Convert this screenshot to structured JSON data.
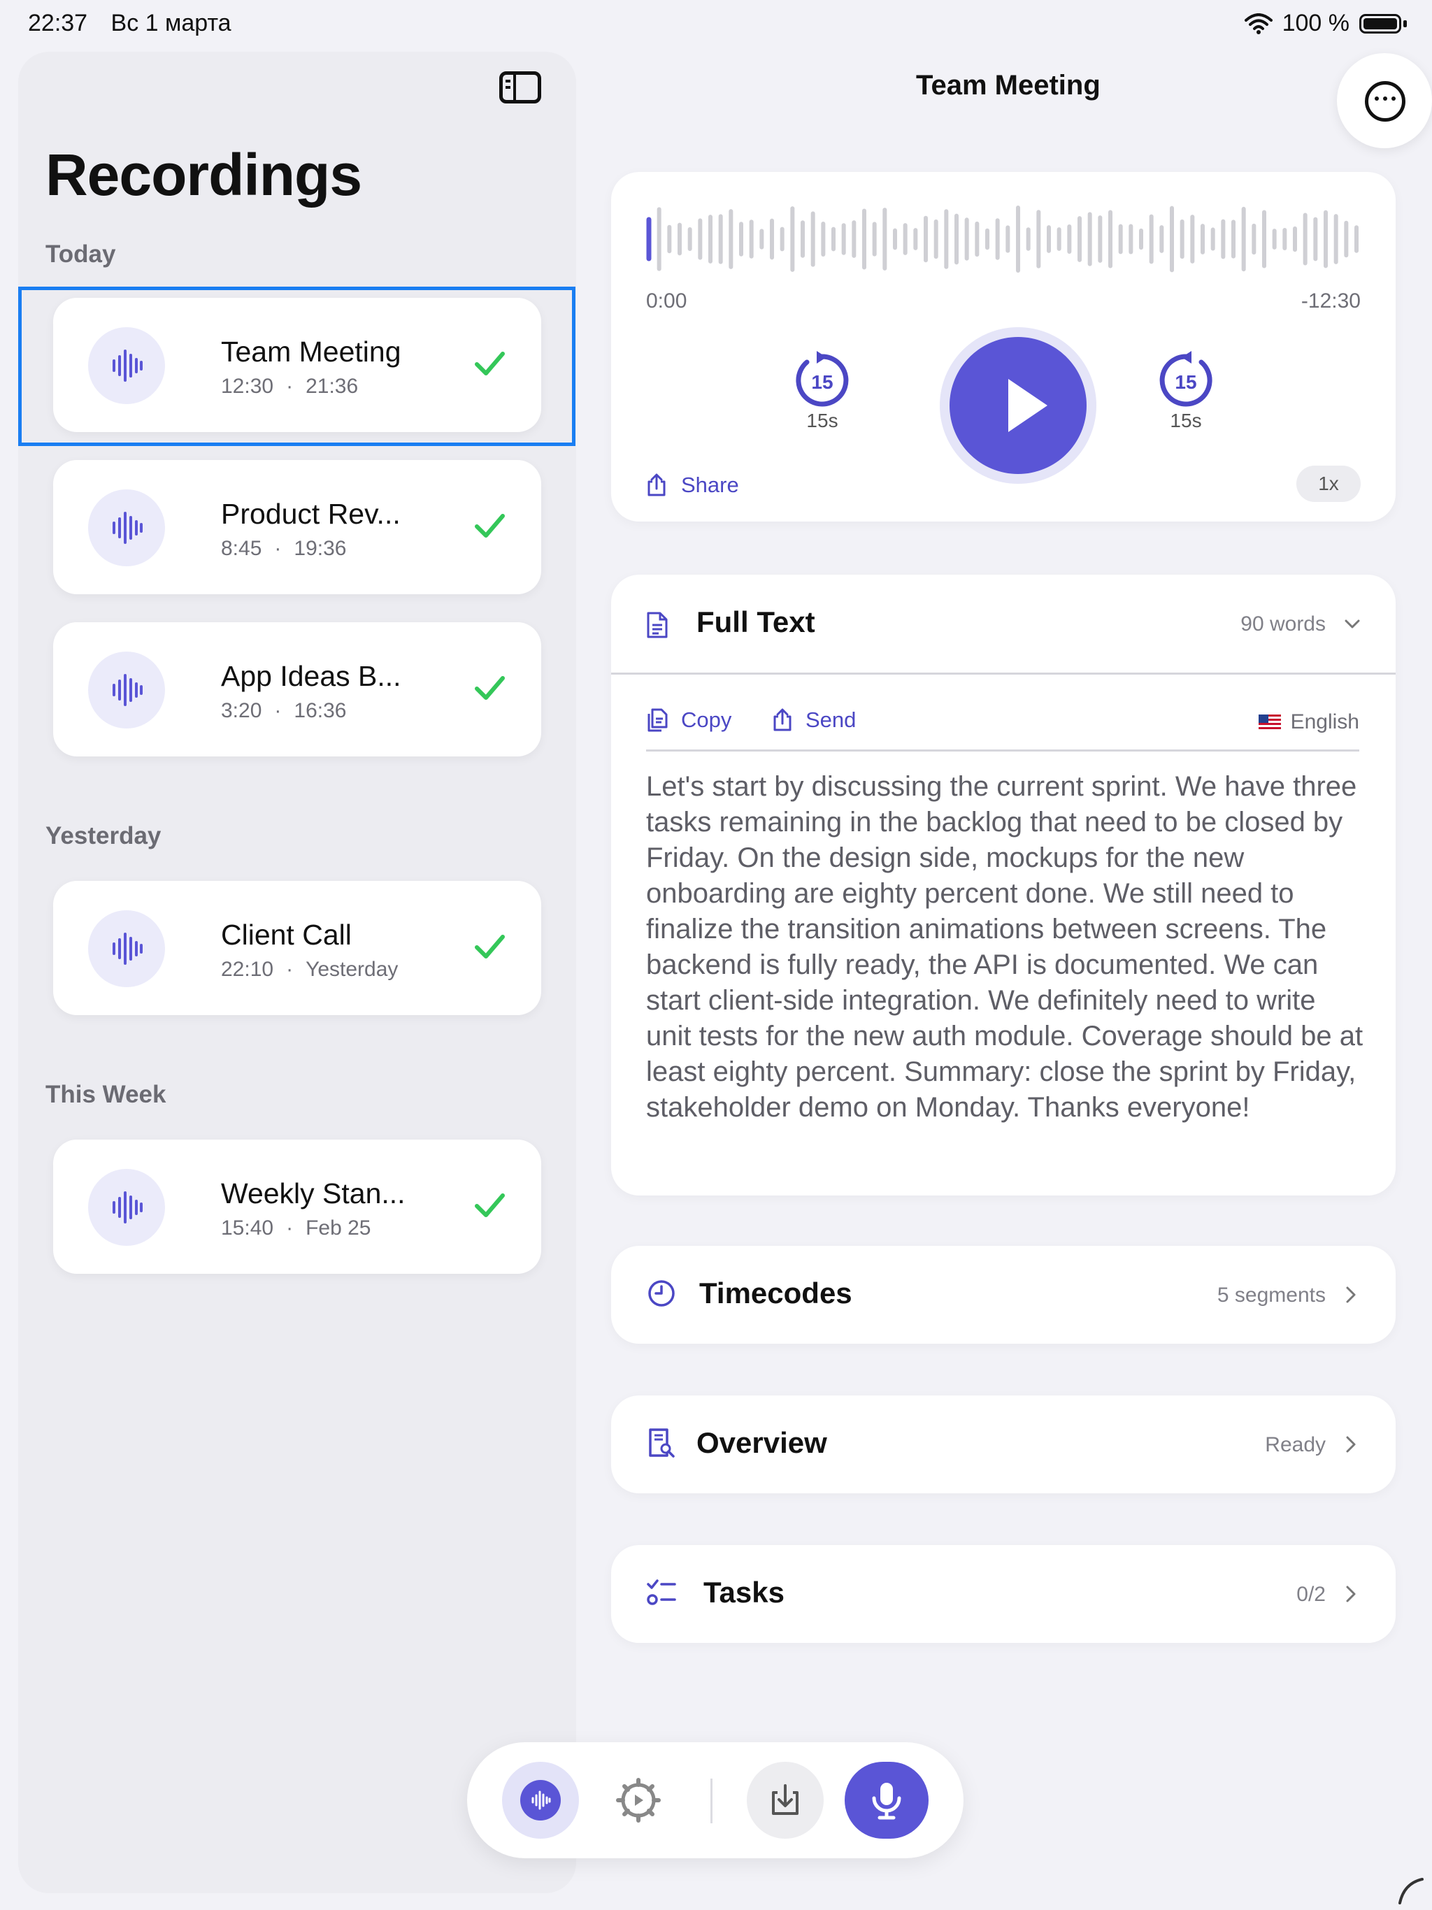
{
  "status_bar": {
    "time": "22:37",
    "date": "Вс 1 марта",
    "battery": "100 %"
  },
  "sidebar": {
    "title": "Recordings",
    "sections": [
      {
        "label": "Today",
        "items": [
          {
            "title": "Team Meeting",
            "duration": "12:30",
            "time": "21:36",
            "status": "done",
            "selected": true
          },
          {
            "title": "Product Rev...",
            "duration": "8:45",
            "time": "19:36",
            "status": "done",
            "selected": false
          },
          {
            "title": "App Ideas B...",
            "duration": "3:20",
            "time": "16:36",
            "status": "done",
            "selected": false
          }
        ]
      },
      {
        "label": "Yesterday",
        "items": [
          {
            "title": "Client Call",
            "duration": "22:10",
            "time": "Yesterday",
            "status": "done",
            "selected": false
          }
        ]
      },
      {
        "label": "This Week",
        "items": [
          {
            "title": "Weekly Stan...",
            "duration": "15:40",
            "time": "Feb 25",
            "status": "done",
            "selected": false
          }
        ]
      }
    ]
  },
  "header": {
    "title": "Team Meeting"
  },
  "player": {
    "time_elapsed": "0:00",
    "time_remaining": "-12:30",
    "skip_back_label": "15s",
    "skip_back_number": "15",
    "skip_forward_label": "15s",
    "skip_forward_number": "15",
    "share_label": "Share",
    "speed_label": "1x",
    "progress": 0
  },
  "full_text": {
    "title": "Full Text",
    "word_count": "90 words",
    "copy_label": "Copy",
    "send_label": "Send",
    "language": "English",
    "body": "Let's start by discussing the current sprint. We have three tasks remaining in the backlog that need to be closed by Friday. On the design side, mockups for the new onboarding are eighty percent done. We still need to finalize the transition animations between screens. The backend is fully ready, the API is documented. We can start client-side integration. We definitely need to write unit tests for the new auth module. Coverage should be at least eighty percent. Summary: close the sprint by Friday, stakeholder demo on Monday. Thanks everyone!"
  },
  "timecodes": {
    "title": "Timecodes",
    "meta": "5 segments"
  },
  "overview": {
    "title": "Overview",
    "meta": "Ready"
  },
  "tasks": {
    "title": "Tasks",
    "meta": "0/2"
  },
  "toolbar": {
    "items": [
      "recordings-icon",
      "settings-icon",
      "import-icon",
      "microphone-icon"
    ]
  },
  "colors": {
    "accent": "#5a55d6",
    "success": "#34c759",
    "selection_frame": "#1a7ef2",
    "background": "#f2f2f7"
  }
}
